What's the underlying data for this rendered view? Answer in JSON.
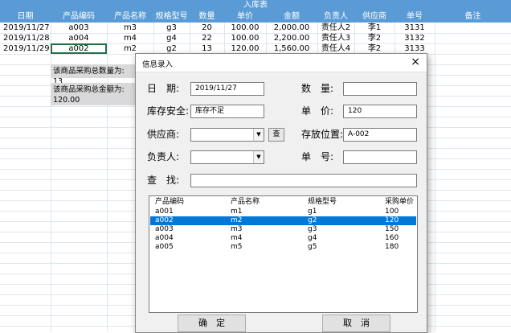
{
  "sheet": {
    "title": "入库表",
    "headers": [
      "日期",
      "产品编码",
      "产品名称",
      "规格型号",
      "数量",
      "单价",
      "金额",
      "负责人",
      "供应商",
      "单号",
      "备注"
    ],
    "rows": [
      [
        "2019/11/27",
        "a003",
        "m3",
        "g3",
        "20",
        "100.00",
        "2,000.00",
        "责任人2",
        "李1",
        "3131",
        ""
      ],
      [
        "2019/11/28",
        "a004",
        "m4",
        "g4",
        "22",
        "100.00",
        "2,200.00",
        "责任人3",
        "李2",
        "3132",
        ""
      ],
      [
        "2019/11/29",
        "a002",
        "m2",
        "g2",
        "13",
        "120.00",
        "1,560.00",
        "责任人4",
        "李2",
        "3133",
        ""
      ]
    ],
    "summary_qty": "该商品采购总数量为: 13",
    "summary_amt_line1": "该商品采购总金额为:",
    "summary_amt_line2": "120.00"
  },
  "dialog": {
    "title": "信息录入",
    "close_glyph": "×",
    "labels": {
      "date": "日　期:",
      "stock_safety": "库存安全:",
      "supplier": "供应商:",
      "owner": "负责人:",
      "search": "查　找:",
      "qty": "数　量:",
      "price": "单　价:",
      "location": "存放位置:",
      "order_no": "单　号:"
    },
    "values": {
      "date": "2019/11/27",
      "stock_safety": "库存不足",
      "supplier": "",
      "owner": "",
      "search": "",
      "qty": "",
      "price": "120",
      "location": "A-002",
      "order_no": ""
    },
    "query_button": "查",
    "dropdown_glyph": "▼",
    "list": {
      "headers": [
        "产品编码",
        "产品名称",
        "规格型号",
        "采购单价"
      ],
      "rows": [
        [
          "a001",
          "m1",
          "g1",
          "100"
        ],
        [
          "a002",
          "m2",
          "g2",
          "120"
        ],
        [
          "a003",
          "m3",
          "g3",
          "150"
        ],
        [
          "a004",
          "m4",
          "g4",
          "160"
        ],
        [
          "a005",
          "m5",
          "g5",
          "180"
        ]
      ],
      "selected_index": 1
    },
    "ok_button": "确　定",
    "cancel_button": "取　消"
  },
  "colors": {
    "header_bg": "#5b9bd5",
    "selection_blue": "#0078d7",
    "grid_line": "#dfe6ee",
    "summary_bg": "#d9d9d9"
  }
}
